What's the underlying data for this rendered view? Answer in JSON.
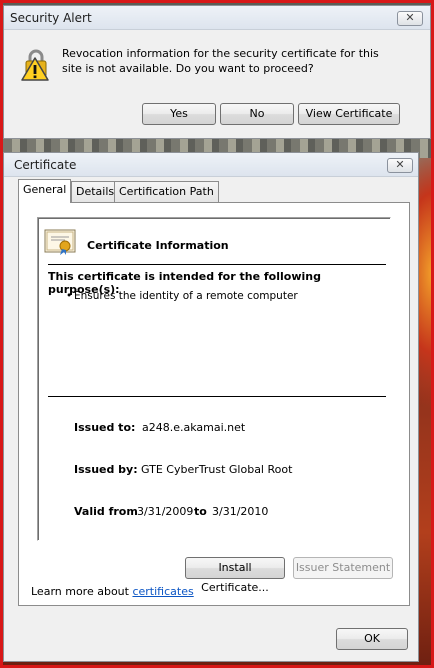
{
  "alert": {
    "title": "Security Alert",
    "close_label": "✕",
    "message": "Revocation information for the security certificate for this site is not available. Do you want to proceed?",
    "buttons": {
      "yes": "Yes",
      "no": "No",
      "view": "View Certificate"
    }
  },
  "certificate": {
    "title": "Certificate",
    "close_label": "✕",
    "tabs": [
      "General",
      "Details",
      "Certification Path"
    ],
    "info_title": "Certificate Information",
    "purpose_heading": "This certificate is intended for the following purpose(s):",
    "purpose_items": [
      "Ensures the identity of a remote computer"
    ],
    "issued_to_label": "Issued to:",
    "issued_to": "a248.e.akamai.net",
    "issued_by_label": "Issued by:",
    "issued_by": "GTE CyberTrust Global Root",
    "valid_from_label": "Valid from",
    "valid_from": "3/31/2009",
    "valid_to_label": "to",
    "valid_to": "3/31/2010",
    "install_button": "Install Certificate...",
    "issuer_statement_button": "Issuer Statement",
    "learn_more_prefix": "Learn more about",
    "learn_more_link": "certificates",
    "ok_button": "OK"
  },
  "icons": {
    "alert": "warning-lock-icon",
    "certificate": "certificate-icon"
  },
  "colors": {
    "frame_border": "#d81818",
    "link": "#0b55c4"
  }
}
